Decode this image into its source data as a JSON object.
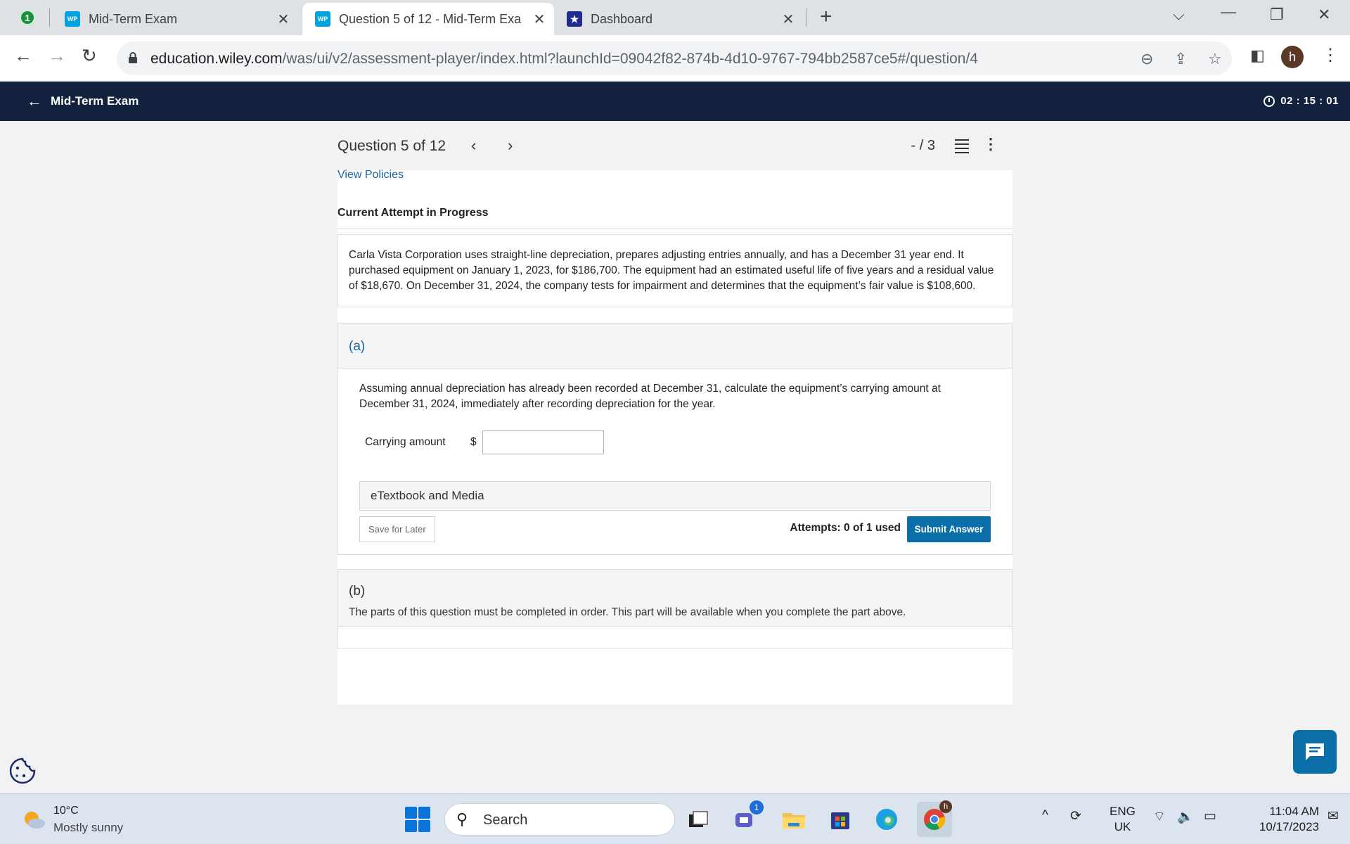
{
  "browser": {
    "tab_counter": "1",
    "tabs": [
      {
        "label": "Mid-Term Exam",
        "favicon": "WP"
      },
      {
        "label": "Question 5 of 12 - Mid-Term Exa",
        "favicon": "WP"
      },
      {
        "label": "Dashboard",
        "favicon": "★"
      }
    ],
    "url": {
      "host": "education.wiley.com",
      "path": "/was/ui/v2/assessment-player/index.html?launchId=09042f82-874b-4d10-9767-794bb2587ce5#/question/4"
    },
    "profile_initial": "h"
  },
  "app": {
    "title": "Mid-Term Exam",
    "timer": "02 : 15 : 01"
  },
  "question": {
    "title": "Question 5 of 12",
    "score": "- / 3",
    "view_policies": "View Policies",
    "attempt_status": "Current Attempt in Progress",
    "problem_text": "Carla Vista Corporation uses straight-line depreciation, prepares adjusting entries annually, and has a December 31 year end. It purchased equipment on January 1, 2023, for $186,700. The equipment had an estimated useful life of five years and a residual value of $18,670. On December 31, 2024, the company tests for impairment and determines that the equipment’s fair value is $108,600."
  },
  "part_a": {
    "label": "(a)",
    "prompt": "Assuming annual depreciation has already been recorded at December 31, calculate the equipment’s carrying amount at December 31, 2024, immediately after recording depreciation for the year.",
    "answer_label": "Carrying amount",
    "currency": "$",
    "answer_value": "",
    "etextbook": "eTextbook and Media",
    "save_label": "Save for Later",
    "attempts": "Attempts: 0 of 1 used",
    "submit_label": "Submit Answer"
  },
  "part_b": {
    "label": "(b)",
    "note": "The parts of this question must be completed in order. This part will be available when you complete the part above."
  },
  "taskbar": {
    "temperature": "10°C",
    "weather": "Mostly sunny",
    "search": "Search",
    "teams_badge": "1",
    "chrome_badge": "h",
    "lang_line1": "ENG",
    "lang_line2": "UK",
    "time": "11:04 AM",
    "date": "10/17/2023"
  },
  "colors": {
    "app_header": "#12213e",
    "accent_blue": "#0a6fa8",
    "link_blue": "#1565a6"
  }
}
